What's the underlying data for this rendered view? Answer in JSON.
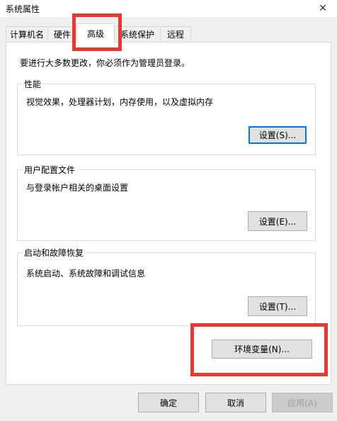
{
  "window": {
    "title": "系统属性"
  },
  "tabs": [
    {
      "label": "计算机名"
    },
    {
      "label": "硬件"
    },
    {
      "label": "高级"
    },
    {
      "label": "系统保护"
    },
    {
      "label": "远程"
    }
  ],
  "admin_note": "要进行大多数更改，你必须作为管理员登录。",
  "groups": {
    "performance": {
      "title": "性能",
      "description": "视觉效果，处理器计划，内存使用，以及虚拟内存",
      "button": "设置(S)..."
    },
    "user_profiles": {
      "title": "用户配置文件",
      "description": "与登录帐户相关的桌面设置",
      "button": "设置(E)..."
    },
    "startup_recovery": {
      "title": "启动和故障恢复",
      "description": "系统启动、系统故障和调试信息",
      "button": "设置(T)..."
    }
  },
  "env_button": "环境变量(N)...",
  "footer": {
    "ok": "确定",
    "cancel": "取消",
    "apply": "应用(A)"
  },
  "colors": {
    "highlight": "#e53935",
    "focus": "#0078d7"
  }
}
